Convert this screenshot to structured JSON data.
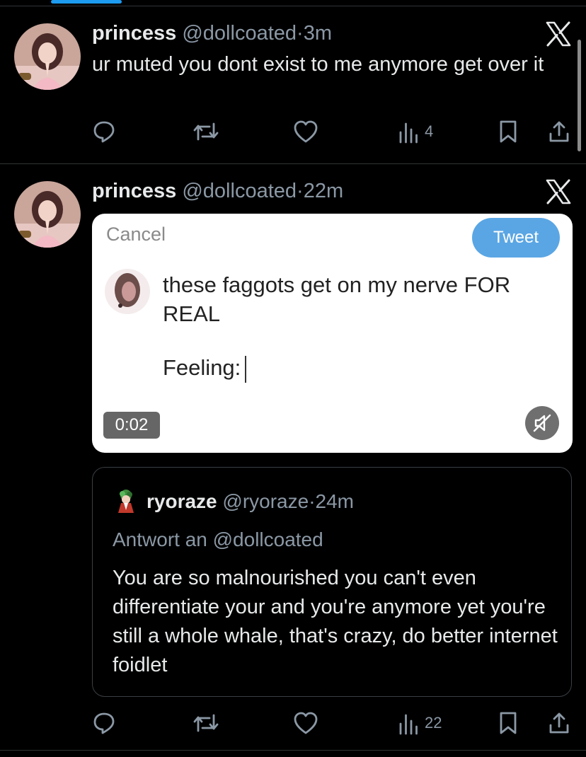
{
  "tweets": [
    {
      "name": "princess",
      "handle": "@dollcoated",
      "dot": "·",
      "time": "3m",
      "text": "ur muted you dont exist to me anymore get over it",
      "views": "4"
    },
    {
      "name": "princess",
      "handle": "@dollcoated",
      "dot": "·",
      "time": "22m",
      "views": "22",
      "media": {
        "cancel": "Cancel",
        "tweet_button": "Tweet",
        "text": "these faggots get on my nerve FOR REAL",
        "feeling": "Feeling:",
        "duration": "0:02"
      },
      "quote": {
        "name": "ryoraze",
        "handle": "@ryoraze",
        "dot": "·",
        "time": "24m",
        "reply_to": "Antwort an @dollcoated",
        "text": "You are so malnourished you can't even differentiate your and you're anymore yet you're still a whole whale, that's crazy, do better internet foidlet"
      }
    }
  ],
  "icons": {
    "reply": "reply-icon",
    "retweet": "retweet-icon",
    "like": "heart-icon",
    "views": "views-icon",
    "bookmark": "bookmark-icon",
    "share": "share-icon",
    "more": "x-logo-icon",
    "mute": "muted-speaker-icon"
  },
  "colors": {
    "background": "#000000",
    "accent": "#1d9bf0",
    "secondary_text": "#8b98a5",
    "divider": "#2f3336"
  }
}
